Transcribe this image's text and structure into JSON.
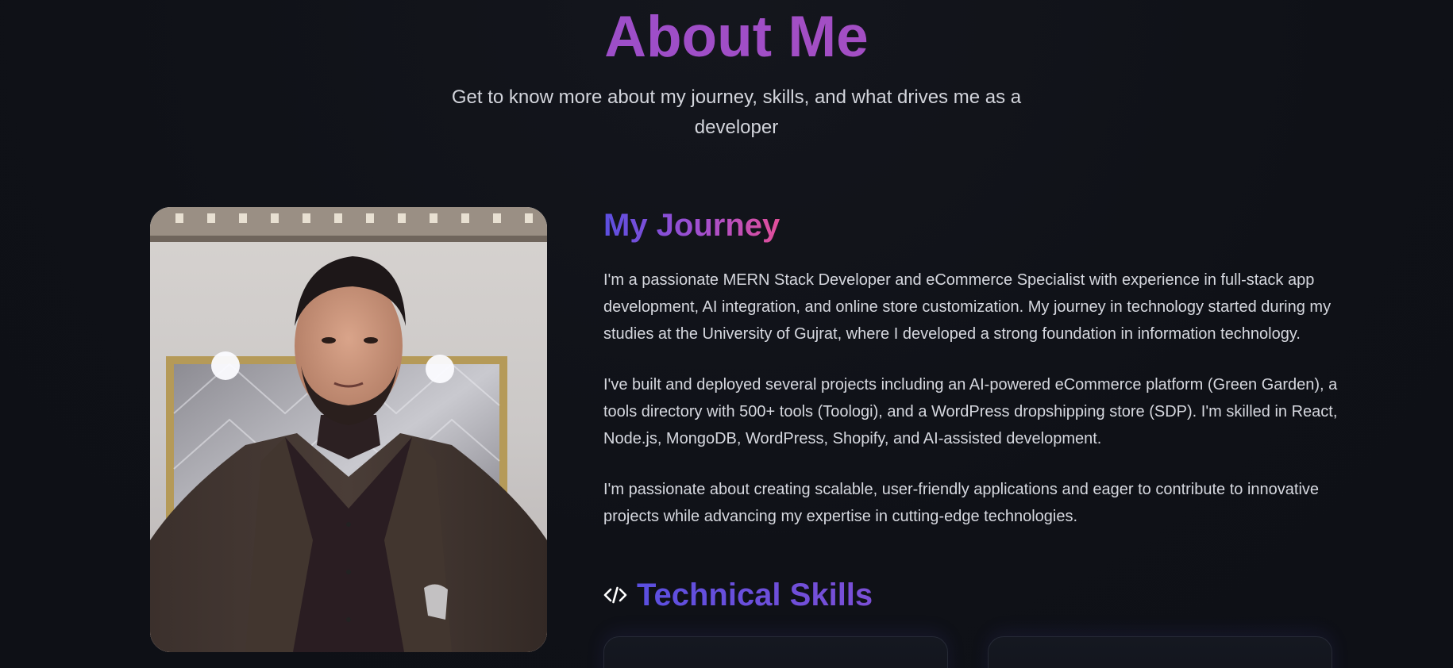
{
  "header": {
    "title": "About Me",
    "subtitle": "Get to know more about my journey, skills, and what drives me as a developer"
  },
  "profile_photo": {
    "alt": "Portrait photo"
  },
  "journey": {
    "title": "My Journey",
    "paragraphs": [
      "I'm a passionate MERN Stack Developer and eCommerce Specialist with experience in full-stack app development, AI integration, and online store customization. My journey in technology started during my studies at the University of Gujrat, where I developed a strong foundation in information technology.",
      "I've built and deployed several projects including an AI-powered eCommerce platform (Green Garden), a tools directory with 500+ tools (Toologi), and a WordPress dropshipping store (SDP). I'm skilled in React, Node.js, MongoDB, WordPress, Shopify, and AI-assisted development.",
      "I'm passionate about creating scalable, user-friendly applications and eager to contribute to innovative projects while advancing my expertise in cutting-edge technologies."
    ]
  },
  "skills": {
    "icon": "code-icon",
    "title": "Technical Skills"
  },
  "colors": {
    "background": "#0f1117",
    "title_gradient": [
      "#8e4fd4",
      "#b24db8"
    ],
    "journey_gradient": [
      "#5b4fe0",
      "#a24fd0",
      "#e24f9a"
    ],
    "body_text": "#d6d8df"
  }
}
